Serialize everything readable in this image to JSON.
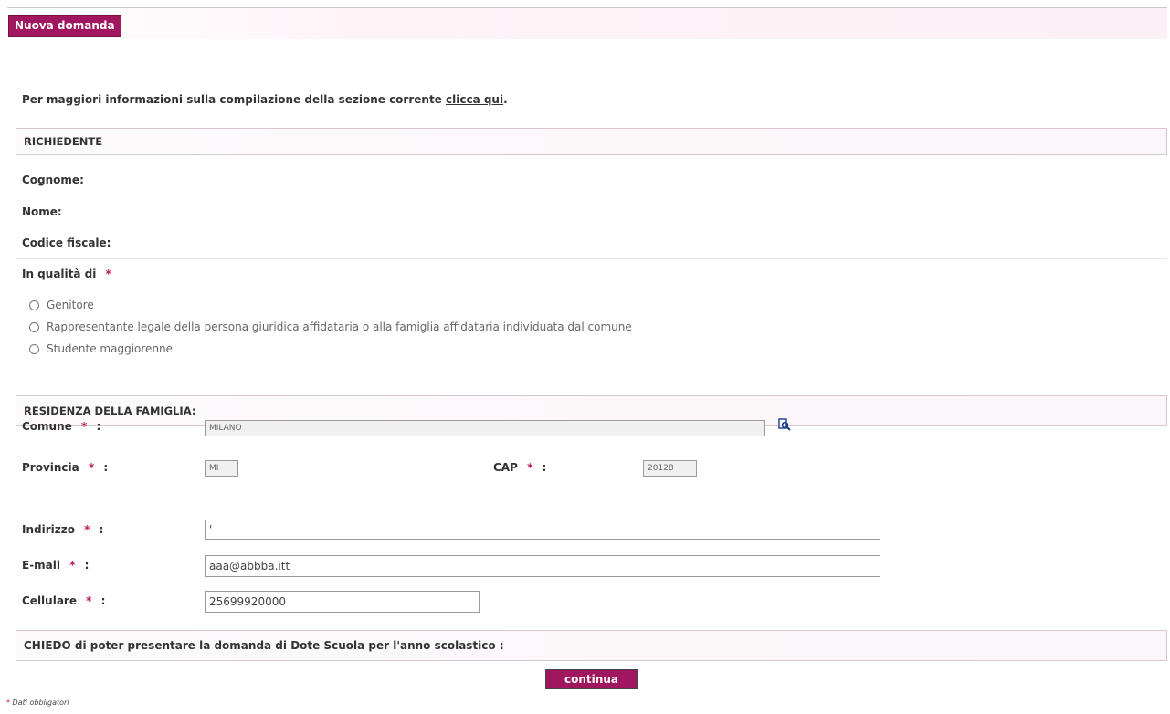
{
  "tab": {
    "label": "Nuova domanda"
  },
  "info": {
    "prefix": "Per maggiori informazioni sulla compilazione della sezione corrente ",
    "link": "clicca qui",
    "suffix": "."
  },
  "richiedente": {
    "header": "RICHIEDENTE",
    "cognome": "Cognome:",
    "nome": "Nome:",
    "codice_fiscale": "Codice fiscale:",
    "qualita": "In qualità di",
    "options": [
      "Genitore",
      "Rappresentante legale della persona giuridica affidataria o alla famiglia affidataria individuata dal comune",
      "Studente maggiorenne"
    ]
  },
  "residenza": {
    "header": "RESIDENZA DELLA FAMIGLIA:",
    "comune_label": "Comune",
    "comune_value": "MILANO",
    "provincia_label": "Provincia",
    "provincia_value": "MI",
    "cap_label": "CAP",
    "cap_value": "20128",
    "indirizzo_label": "Indirizzo",
    "indirizzo_value": "'",
    "email_label": "E-mail",
    "email_value": "aaa@abbba.itt",
    "cellulare_label": "Cellulare",
    "cellulare_value": "25699920000"
  },
  "req_mark": "*",
  "colon": ":",
  "chiedo": {
    "text": "CHIEDO di poter presentare la domanda di Dote Scuola per l'anno scolastico :"
  },
  "buttons": {
    "continua": "continua"
  },
  "footnote": {
    "mark": "*",
    "text": " Dati obbligatori"
  },
  "colors": {
    "brand": "#a0165f",
    "required": "#c0155f"
  },
  "icons": {
    "lookup": "search-lookup-icon"
  }
}
